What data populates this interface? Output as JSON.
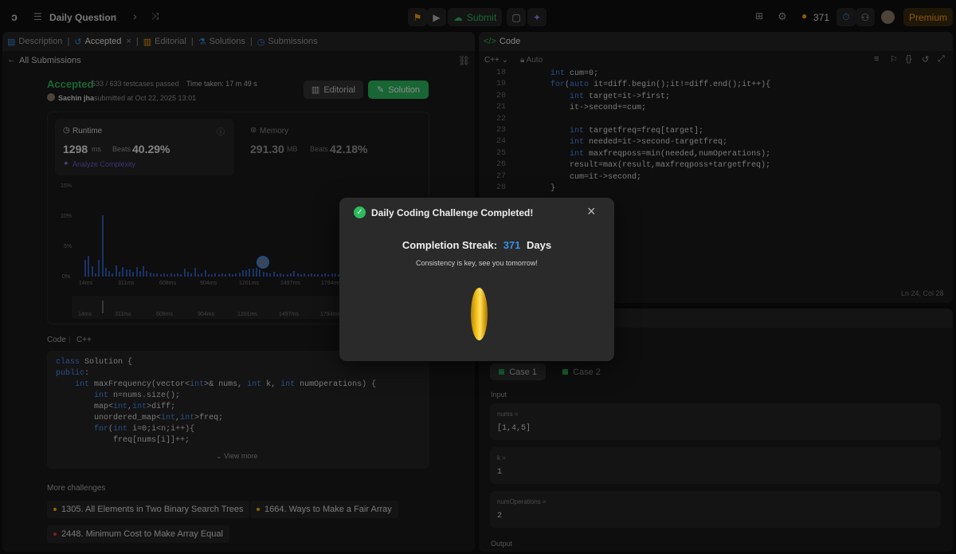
{
  "topbar": {
    "title": "Daily Question",
    "submit_label": "Submit",
    "streak_count": "371",
    "premium_label": "Premium"
  },
  "left_tabs": [
    {
      "label": "Description"
    },
    {
      "label": "Accepted"
    },
    {
      "label": "Editorial"
    },
    {
      "label": "Solutions"
    },
    {
      "label": "Submissions"
    }
  ],
  "submission": {
    "back_label": "All Submissions",
    "status": "Accepted",
    "testcases": "633 / 633 testcases passed",
    "time_taken": "Time taken: 17 m 49 s",
    "user": "Sachin jha",
    "submitted_at": "submitted at Oct 22, 2025 13:01",
    "editorial_btn": "Editorial",
    "solution_btn": "Solution",
    "runtime_label": "Runtime",
    "runtime_value": "1298",
    "runtime_unit": "ms",
    "beats_label": "Beats",
    "runtime_beats": "40.29%",
    "analyze_label": "Analyze Complexity",
    "memory_label": "Memory",
    "memory_value": "291.30",
    "memory_unit": "MB",
    "memory_beats": "42.18%"
  },
  "chart_data": {
    "type": "bar",
    "y_ticks": [
      "15%",
      "10%",
      "5%",
      "0%"
    ],
    "x_ticks": [
      "14ms",
      "311ms",
      "608ms",
      "904ms",
      "1201ms",
      "1497ms",
      "1794ms"
    ],
    "ylim": [
      0,
      15
    ],
    "values": [
      3.3,
      4.1,
      2.1,
      0.7,
      3.3,
      12.2,
      1.7,
      1.1,
      0.7,
      2.2,
      0.9,
      1.9,
      1.5,
      1.4,
      0.9,
      1.9,
      1.1,
      2.1,
      1.1,
      0.8,
      0.6,
      0.6,
      0.5,
      0.6,
      0.5,
      0.6,
      0.5,
      0.7,
      0.5,
      1.6,
      0.9,
      0.6,
      1.7,
      0.5,
      0.6,
      1.3,
      0.5,
      0.5,
      0.6,
      0.5,
      0.7,
      0.5,
      0.6,
      0.5,
      0.6,
      0.8,
      1.2,
      1.3,
      1.6,
      1.6,
      1.7,
      1.5,
      1.0,
      0.8,
      0.6,
      0.9,
      0.5,
      0.6,
      0.5,
      0.4,
      0.6,
      1.1,
      0.6,
      0.5,
      0.7,
      0.5,
      0.6,
      0.5,
      0.4,
      0.5,
      0.6,
      0.5,
      0.6,
      0.7,
      0.5
    ]
  },
  "code_section": {
    "label": "Code",
    "lang": "C++",
    "lines": [
      "class Solution {",
      "public:",
      "    int maxFrequency(vector<int>& nums, int k, int numOperations) {",
      "        int n=nums.size();",
      "        map<int,int>diff;",
      "        unordered_map<int,int>freq;",
      "        for(int i=0;i<n;i++){",
      "            freq[nums[i]]++;"
    ],
    "view_more": "View more"
  },
  "more_challenges": {
    "label": "More challenges",
    "items": [
      {
        "text": "1305. All Elements in Two Binary Search Trees",
        "color": "#ffb800"
      },
      {
        "text": "1664. Ways to Make a Fair Array",
        "color": "#ffb800"
      },
      {
        "text": "2448. Minimum Cost to Make Array Equal",
        "color": "#f63636"
      }
    ]
  },
  "editor": {
    "title": "Code",
    "lang": "C++",
    "mode": "Auto",
    "status": "Ln 24, Col 28",
    "lines": [
      {
        "n": "18",
        "t": "        int cum=0;"
      },
      {
        "n": "19",
        "t": "        for(auto it=diff.begin();it!=diff.end();it++){"
      },
      {
        "n": "20",
        "t": "            int target=it->first;"
      },
      {
        "n": "21",
        "t": "            it->second+=cum;"
      },
      {
        "n": "22",
        "t": ""
      },
      {
        "n": "23",
        "t": "            int targetfreq=freq[target];"
      },
      {
        "n": "24",
        "t": "            int needed=it->second-targetfreq;"
      },
      {
        "n": "25",
        "t": "            int maxfreqposs=min(needed,numOperations);"
      },
      {
        "n": "26",
        "t": "            result=max(result,maxfreqposs+targetfreq);"
      },
      {
        "n": "27",
        "t": "            cum=it->second;"
      },
      {
        "n": "28",
        "t": "        }"
      }
    ]
  },
  "testcases": {
    "case1": "Case 1",
    "case2": "Case 2",
    "input_label": "Input",
    "fields": [
      {
        "name": "nums =",
        "value": "[1,4,5]"
      },
      {
        "name": "k =",
        "value": "1"
      },
      {
        "name": "numOperations =",
        "value": "2"
      }
    ],
    "output_label": "Output"
  },
  "modal": {
    "title": "Daily Coding Challenge Completed!",
    "streak_label": "Completion Streak:",
    "streak_value": "371",
    "streak_unit": "Days",
    "subtitle": "Consistency is key, see you tomorrow!"
  },
  "colors": {
    "accent_green": "#2cbb5d",
    "accent_blue": "#3a8ee6",
    "streak_orange": "#ffa116",
    "coin_gold": "#f5c518"
  }
}
